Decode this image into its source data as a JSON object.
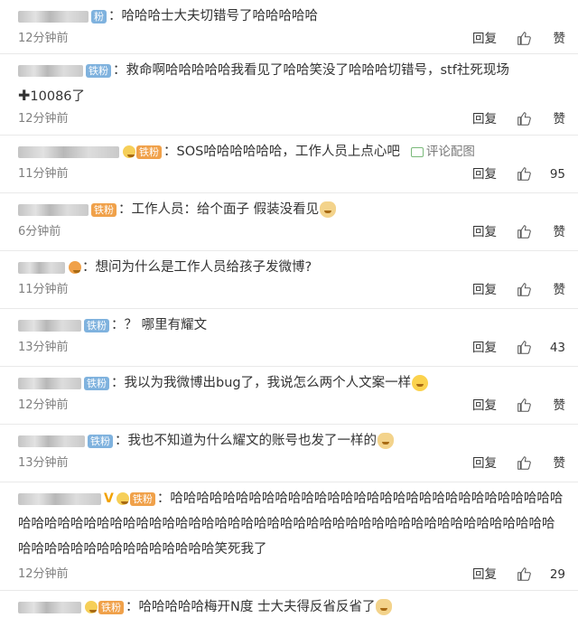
{
  "actions": {
    "reply_label": "回复",
    "like_label": "赞"
  },
  "comments": [
    {
      "badge": "粉",
      "text": "：哈哈哈士大夫切错号了哈哈哈哈哈",
      "time": "12分钟前",
      "likes": "赞"
    },
    {
      "badge": "铁粉",
      "text": "：救命啊哈哈哈哈哈我看见了哈哈笑没了哈哈哈切错号，stf社死现场",
      "text2": "10086了",
      "time": "12分钟前",
      "likes": "赞"
    },
    {
      "badge": "铁粉",
      "text": "：SOS哈哈哈哈哈哈，工作人员上点心吧",
      "pic": "评论配图",
      "time": "11分钟前",
      "likes": "95"
    },
    {
      "badge": "铁粉",
      "text": "：工作人员：给个面子 假装没看见",
      "time": "6分钟前",
      "likes": "赞"
    },
    {
      "badge": "",
      "text": "：想问为什么是工作人员给孩子发微博?",
      "time": "11分钟前",
      "likes": "赞"
    },
    {
      "badge": "铁粉",
      "text": "：？ 哪里有耀文",
      "time": "13分钟前",
      "likes": "43"
    },
    {
      "badge": "铁粉",
      "text": "：我以为我微博出bug了，我说怎么两个人文案一样",
      "time": "12分钟前",
      "likes": "赞"
    },
    {
      "badge": "铁粉",
      "text": "：我也不知道为什么耀文的账号也发了一样的",
      "time": "13分钟前",
      "likes": "赞"
    },
    {
      "badge": "铁粉",
      "text": "：哈哈哈哈哈哈哈哈哈哈哈哈哈哈哈哈哈哈哈哈哈哈哈哈哈哈哈哈哈哈哈哈哈哈哈哈哈哈哈哈哈哈哈哈哈哈哈哈哈哈哈哈哈哈哈哈哈哈哈哈哈哈哈哈哈哈哈哈哈哈哈哈哈哈哈哈哈哈哈哈哈哈哈哈哈哈笑死我了",
      "time": "12分钟前",
      "likes": "29"
    },
    {
      "badge": "铁粉",
      "text": "：哈哈哈哈哈梅开N度 士大夫得反省反省了",
      "time": "",
      "likes": ""
    }
  ]
}
